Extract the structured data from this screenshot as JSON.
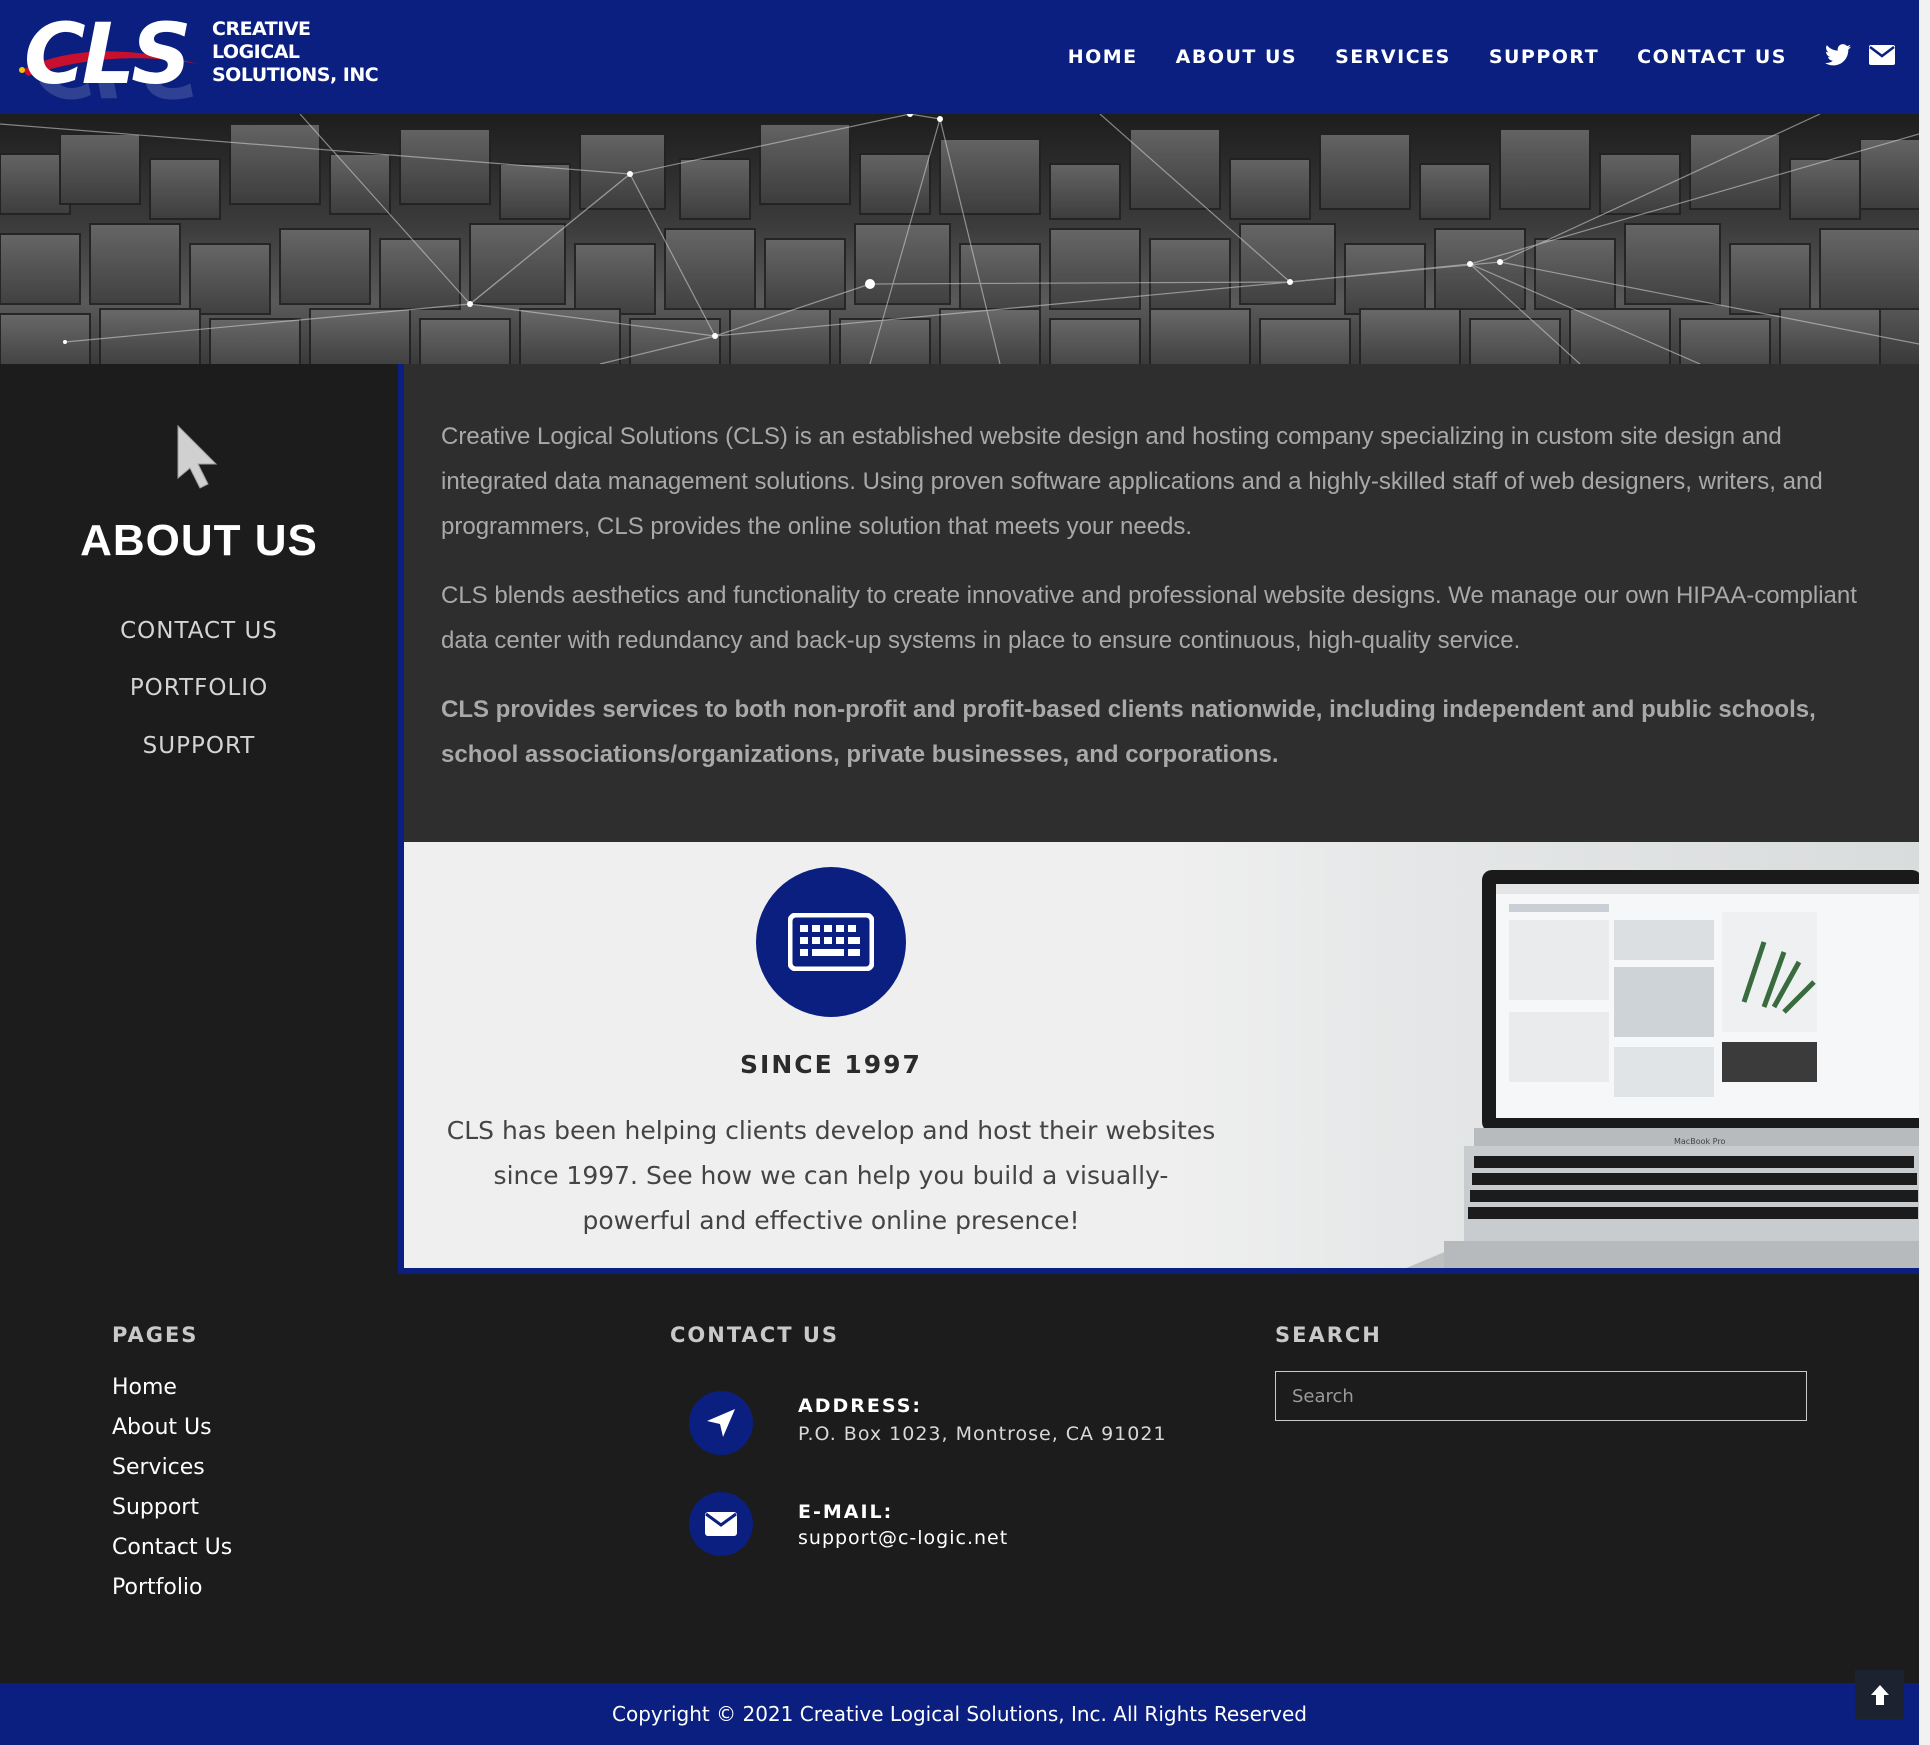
{
  "brand": {
    "logo_letters": "CLS",
    "name_line1": "CREATIVE",
    "name_line2": "LOGICAL",
    "name_line3": "SOLUTIONS, INC"
  },
  "nav": {
    "items": [
      "HOME",
      "ABOUT US",
      "SERVICES",
      "SUPPORT",
      "CONTACT US"
    ],
    "social_icons": [
      "twitter-icon",
      "envelope-icon"
    ]
  },
  "sidebar": {
    "icon": "cursor-icon",
    "title": "ABOUT US",
    "links": [
      "CONTACT US",
      "PORTFOLIO",
      "SUPPORT"
    ]
  },
  "content": {
    "paragraph1": "Creative Logical Solutions (CLS) is an established website design and hosting company specializing in custom site design and integrated data management solutions. Using proven software applications and a highly-skilled staff of web designers, writers, and programmers, CLS provides the online solution that meets your needs.",
    "paragraph2": "CLS blends aesthetics and functionality to create innovative and professional website designs. We manage our own HIPAA-compliant data center with redundancy and back-up systems in place to ensure continuous, high-quality service.",
    "paragraph3": "CLS provides services to both non-profit and profit-based clients nationwide, including independent and public schools, school associations/organizations, private businesses, and corporations."
  },
  "feature": {
    "icon": "keyboard-icon",
    "heading": "SINCE 1997",
    "text": "CLS has been helping clients develop and host their websites since 1997. See how we can help you build a visually-powerful and effective online presence!",
    "laptop_brand": "MacBook Pro"
  },
  "footer": {
    "pages_heading": "PAGES",
    "pages": [
      "Home",
      "About Us",
      "Services",
      "Support",
      "Contact Us",
      "Portfolio"
    ],
    "contact_heading": "CONTACT US",
    "address_label": "ADDRESS:",
    "address_value": "P.O. Box 1023, Montrose, CA 91021",
    "email_label": "E-MAIL:",
    "email_value": "support@c-logic.net",
    "search_heading": "SEARCH",
    "search_placeholder": "Search",
    "copyright": "Copyright © 2021 Creative Logical Solutions, Inc. All Rights Reserved"
  },
  "colors": {
    "brand_blue": "#0a1f7f",
    "dark_bg": "#1c1c1c",
    "content_bg": "#2e2e2e",
    "light_panel": "#efefef"
  }
}
